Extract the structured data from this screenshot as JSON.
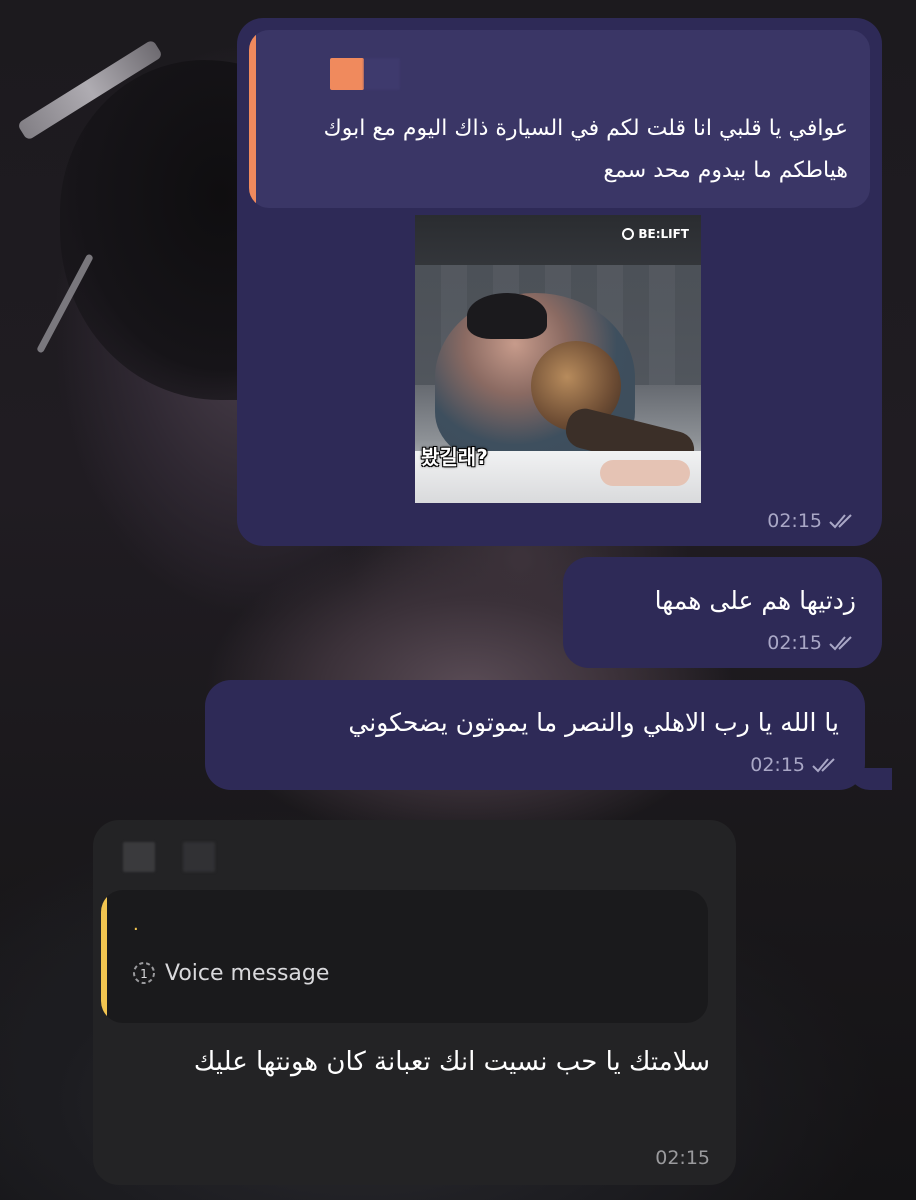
{
  "messages": [
    {
      "direction": "outgoing",
      "reply": {
        "text": "عوافي يا قلبي انا قلت لكم في السيارة ذاك اليوم مع ابوك هياطكم ما بيدوم محد سمع"
      },
      "media": {
        "logo": "BE:LIFT",
        "caption": "봤길래?"
      },
      "time": "02:15",
      "status": "read"
    },
    {
      "direction": "outgoing",
      "text": "زدتيها هم على همها",
      "time": "02:15",
      "status": "read"
    },
    {
      "direction": "outgoing",
      "text": "يا الله يا رب الاهلي والنصر ما يموتون يضحكوني",
      "time": "02:15",
      "status": "read"
    },
    {
      "direction": "incoming",
      "quote": {
        "name": "٠",
        "label": "Voice message"
      },
      "text": "سلامتك يا حب نسيت انك تعبانة كان هونتها عليك",
      "time": "02:15"
    }
  ],
  "colors": {
    "outgoing_bubble": "#2e2a57",
    "incoming_bubble": "#232325",
    "reply_accent": "#f08a5d",
    "quote_accent": "#f2c550"
  },
  "icons": {
    "read_status": "double-check-icon",
    "voice": "voice-timer-icon"
  }
}
